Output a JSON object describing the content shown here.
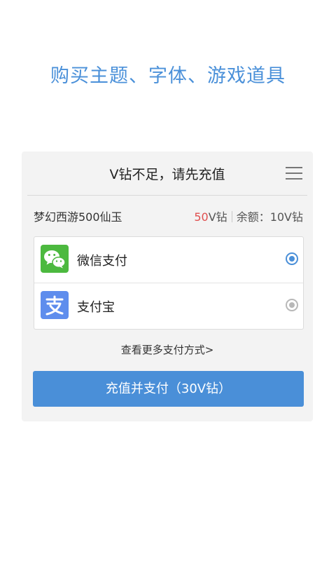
{
  "headline": "购买主题、字体、游戏道具",
  "dialog": {
    "title": "V钻不足，请先充值",
    "menu_icon": "menu-icon",
    "item": {
      "name": "梦幻西游500仙玉",
      "price_value": "50",
      "price_unit": "V钻",
      "balance": "余额：10V钻"
    },
    "payment_options": [
      {
        "label": "微信支付",
        "icon": "wechat-icon",
        "selected": true,
        "color": "#4cb93f"
      },
      {
        "label": "支付宝",
        "icon": "alipay-icon",
        "selected": false,
        "color": "#5e8ded"
      }
    ],
    "more_methods": "查看更多支付方式>",
    "confirm_button": "充值并支付（30V钻）"
  },
  "colors": {
    "accent": "#4a8fd8",
    "headline": "#4a90d9",
    "price": "#e05050",
    "dialog_bg": "#f3f3f3"
  }
}
